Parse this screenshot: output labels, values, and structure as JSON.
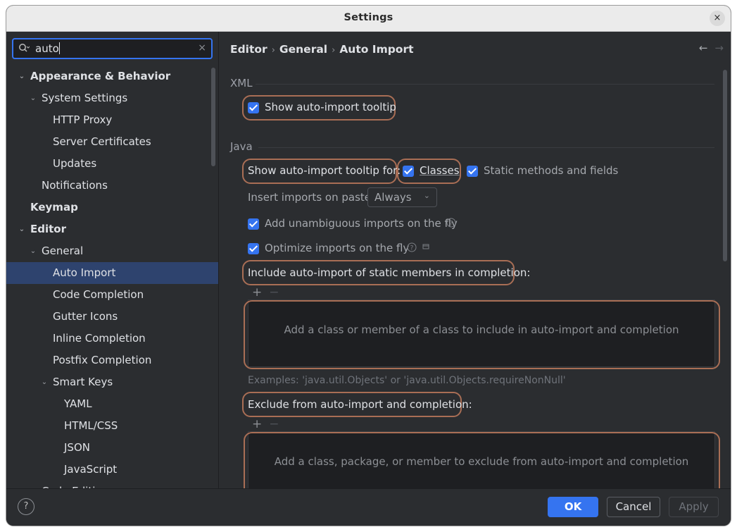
{
  "window": {
    "title": "Settings",
    "close_glyph": "×"
  },
  "search": {
    "value": "auto",
    "icon": "search-icon",
    "clear_glyph": "×"
  },
  "tree": {
    "items": [
      {
        "label": "Appearance & Behavior",
        "level": 0,
        "arrow": "expanded",
        "bold": true
      },
      {
        "label": "System Settings",
        "level": 1,
        "arrow": "expanded"
      },
      {
        "label": "HTTP Proxy",
        "level": 2
      },
      {
        "label": "Server Certificates",
        "level": 2
      },
      {
        "label": "Updates",
        "level": 2
      },
      {
        "label": "Notifications",
        "level": 1
      },
      {
        "label": "Keymap",
        "level": 0,
        "bold": true
      },
      {
        "label": "Editor",
        "level": 0,
        "arrow": "expanded",
        "bold": true
      },
      {
        "label": "General",
        "level": 1,
        "arrow": "expanded"
      },
      {
        "label": "Auto Import",
        "level": 2,
        "selected": true
      },
      {
        "label": "Code Completion",
        "level": 2
      },
      {
        "label": "Gutter Icons",
        "level": 2
      },
      {
        "label": "Inline Completion",
        "level": 2
      },
      {
        "label": "Postfix Completion",
        "level": 2
      },
      {
        "label": "Smart Keys",
        "level": 2,
        "arrow": "expanded"
      },
      {
        "label": "YAML",
        "level": 3
      },
      {
        "label": "HTML/CSS",
        "level": 3
      },
      {
        "label": "JSON",
        "level": 3
      },
      {
        "label": "JavaScript",
        "level": 3
      },
      {
        "label": "Code Editing",
        "level": 1
      }
    ]
  },
  "breadcrumb": {
    "items": [
      "Editor",
      "General",
      "Auto Import"
    ],
    "separator": "›",
    "back_glyph": "←",
    "forward_glyph": "→"
  },
  "xml": {
    "section": "XML",
    "show_tooltip_label": "Show auto-import tooltip",
    "show_tooltip_checked": true
  },
  "java": {
    "section": "Java",
    "tooltip_for_label": "Show auto-import tooltip for:",
    "classes_label": "Classes",
    "classes_checked": true,
    "static_label": "Static methods and fields",
    "static_checked": true,
    "insert_on_paste_label": "Insert imports on paste:",
    "insert_on_paste_value": "Always",
    "unambiguous_label": "Add unambiguous imports on the fly",
    "unambiguous_checked": true,
    "optimize_label": "Optimize imports on the fly",
    "optimize_checked": true,
    "include_label": "Include auto-import of static members in completion:",
    "include_empty": "Add a class or member of a class to include in auto-import and completion",
    "examples": "Examples: 'java.util.Objects' or 'java.util.Objects.requireNonNull'",
    "exclude_label": "Exclude from auto-import and completion:",
    "exclude_empty": "Add a class, package, or member to exclude from auto-import and completion",
    "add_glyph": "+",
    "remove_glyph": "−"
  },
  "footer": {
    "help_glyph": "?",
    "ok": "OK",
    "cancel": "Cancel",
    "apply": "Apply"
  },
  "colors": {
    "accent": "#3574f0",
    "highlight_outline": "#a96e55",
    "selection": "#2e436e"
  }
}
